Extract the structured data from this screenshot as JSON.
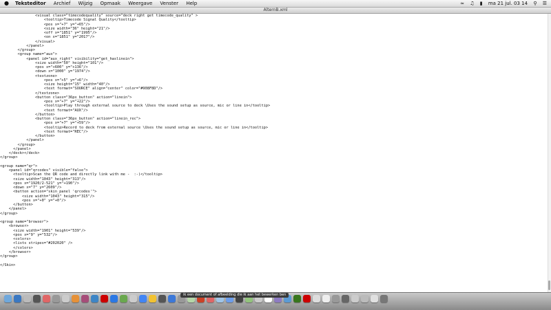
{
  "menubar": {
    "apple": "",
    "app_name": "Teksteditor",
    "items": [
      "Archief",
      "Wijzig",
      "Opmaak",
      "Weergave",
      "Venster",
      "Help"
    ],
    "clock": "ma 21 jul.  03 14"
  },
  "window": {
    "title": "AlternB.xml",
    "close_color": "#fc5f57",
    "minimize_color": "#fdbb2e",
    "zoom_color": "#29c83f"
  },
  "code_lines": [
    "                <visual class=\"timecodequality\" source=\"deck right get timecode_quality\" >",
    "                    <tooltip>Timecode Signal Quality</tooltip>",
    "                    <pos x=\"+7\" y=\"+65\"/>",
    "                    <size width=\"36\" height=\"21\"/>",
    "                    <off x=\"1851\" y=\"1995\"/>",
    "                    <on x=\"1851\" y=\"2017\"/>",
    "                </visual>",
    "            </panel>",
    "        </group>",
    "        <group name=\"aux\">",
    "            <panel id=\"aux_right\" visibility=\"get_haslinein\">",
    "                <size width=\"50\" height=\"101\"/>",
    "                <pos x=\"+600\" y=\"+136\"/>",
    "                <down x=\"1000\" y=\"1974\"/>",
    "                <textzone>",
    "                    <pos x=\"+5\" y=\"+6\"/>",
    "                    <size height=\"15\" width=\"40\"/>",
    "                    <text format=\"SOURCE\" align=\"center\" color=\"#908F8D\"/>",
    "                </textzone>",
    "                <button class=\"36px_button\" action=\"linein\">",
    "                    <pos x=\"+7\" y=\"+22\"/>",
    "                    <tooltip>Play through external source to deck \\Uses the sound setup as source, mic or line in</tooltip>",
    "                    <text format=\"AUX\"/>",
    "                </button>",
    "                <button class=\"36px_button\" action=\"linein_rec\">",
    "                    <pos x=\"+7\" y=\"+59\"/>",
    "                    <tooltip>Record to deck from external source \\Uses the sound setup as source, mic or line in</tooltip>",
    "                    <text format=\"REC\"/>",
    "                </button>",
    "            </panel>",
    "        </group>",
    "      </panel>",
    "    </deck></deck>",
    "</group>",
    "",
    "<group name=\"qr\">",
    "    <panel id=\"qrcodes\" visible=\"false\">",
    "      <tooltip>Scan the QR code and directly link with me -  :-)</tooltip>",
    "      <size width=\"1043\" height=\"313\"/>",
    "      <pos x=\"1920/2-521\" y=\"+190\"/>",
    "      <down x=\"7\" y=\"2609\"/>",
    "      <button action=\"skin_panel 'qrcodes'\">",
    "          <size width=\"1043\" height=\"315\"/>",
    "          <pos x=\"+0\" y=\"+0\"/>",
    "      </button>",
    "    </panel>",
    "</group>",
    "",
    "<group name=\"browser\">",
    "    <browser>",
    "      <size width=\"1901\" height=\"539\"/>",
    "      <pos x=\"9\" y=\"532\"/>",
    "      <colors>",
    "      <lists stripes=\"#202020\" />",
    "      </colors>",
    "    </browser>",
    "</group>",
    "",
    "</Skin>"
  ],
  "dock": {
    "tooltip": "ik een document of afbeelding die ik aan het bewerken ben",
    "icon_colors": [
      "#6fa8dc",
      "#3a78c2",
      "#bbbbbb",
      "#555555",
      "#e06666",
      "#999999",
      "#cccccc",
      "#e69138",
      "#a64d79",
      "#3d85c6",
      "#cc0000",
      "#2b78e4",
      "#6aa84f",
      "#cccccc",
      "#4285f4",
      "#f1c232",
      "#555555",
      "#3c78d8",
      "#999999",
      "#b6d7a8",
      "#cc4125",
      "#e06666",
      "#9fc5e8",
      "#6d9eeb",
      "#444444",
      "#93c47d",
      "#cccccc",
      "#ffffff",
      "#8e7cc3",
      "#5b9bd5",
      "#38761d",
      "#cc0000",
      "#dddddd",
      "#eeeeee",
      "#999999",
      "#666666",
      "#cccccc",
      "#bbbbbb",
      "#e0e0e0",
      "#777777"
    ]
  }
}
